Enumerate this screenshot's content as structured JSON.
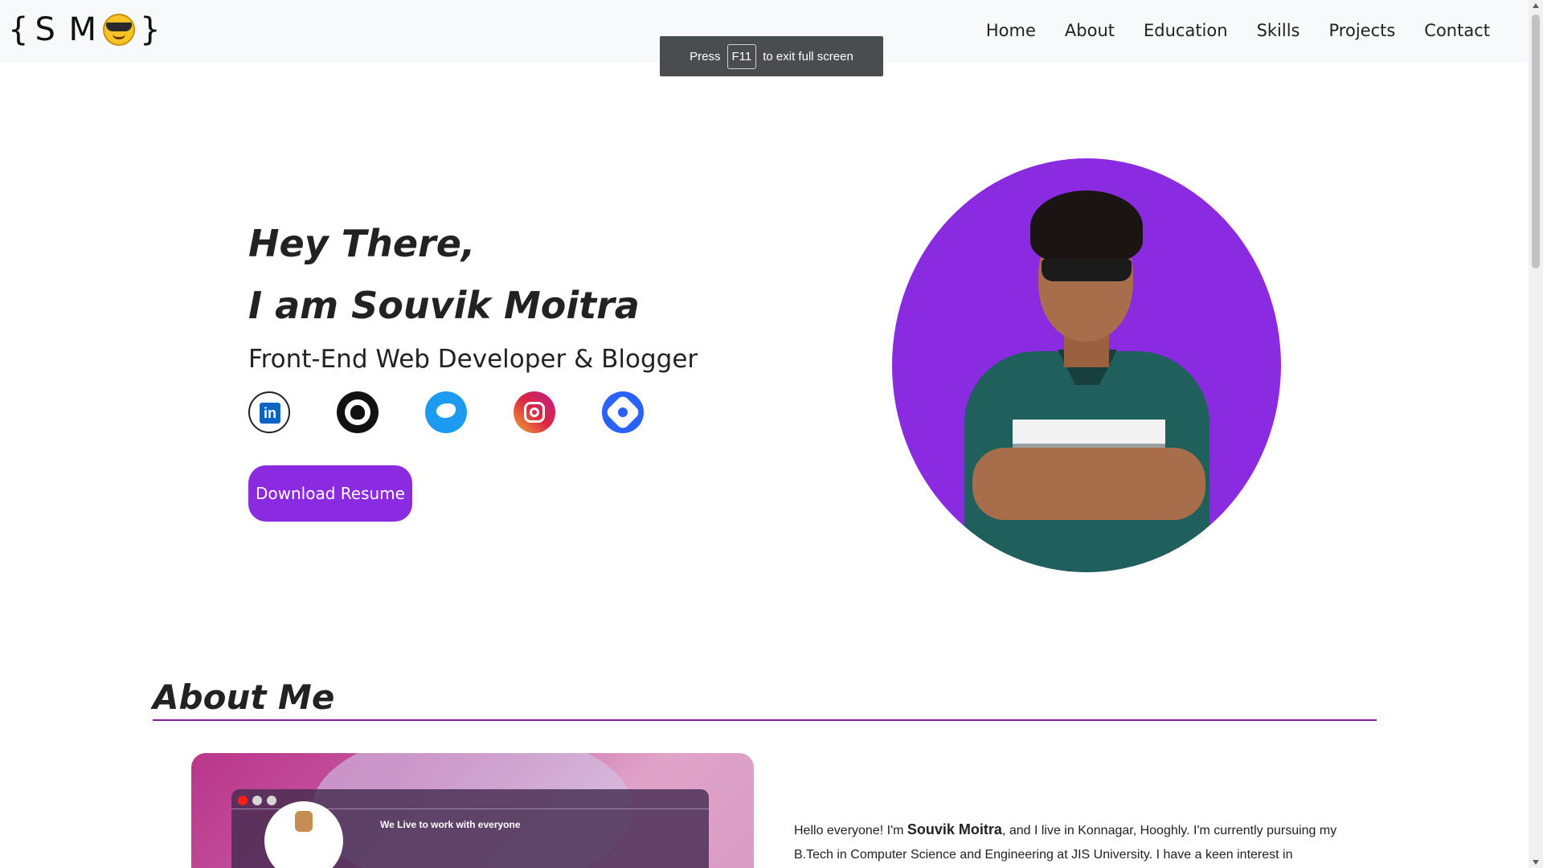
{
  "brand": {
    "open": "{",
    "letters": "S M",
    "close": "}",
    "emoji": "smiling-face-with-sunglasses"
  },
  "nav": [
    "Home",
    "About",
    "Education",
    "Skills",
    "Projects",
    "Contact"
  ],
  "fullscreen_toast": {
    "prefix": "Press",
    "key": "F11",
    "suffix": "to exit full screen"
  },
  "hero": {
    "greeting": "Hey There,",
    "name": "I am Souvik Moitra",
    "role": "Front-End Web Developer & Blogger",
    "socials": [
      "linkedin-icon",
      "github-icon",
      "twitter-icon",
      "instagram-icon",
      "hashnode-icon"
    ],
    "button": "Download Resume"
  },
  "about": {
    "title": "About Me",
    "card_tagline": "We Live to work with everyone",
    "text_intro": "Hello everyone! I'm ",
    "text_name": "Souvik Moitra",
    "text_rest": ", and I live in Konnagar, Hooghly. I'm currently pursuing my B.Tech in Computer Science and Engineering at JIS University. I have a keen interest in"
  },
  "colors": {
    "accent": "#8a2be2",
    "navbar_bg": "#f8f9fa",
    "about_line": "#8a1f9e"
  }
}
